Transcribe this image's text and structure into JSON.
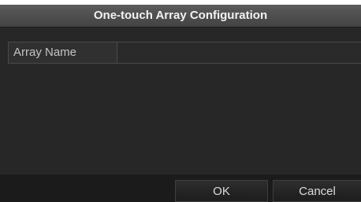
{
  "dialog": {
    "title": "One-touch Array Configuration",
    "fields": {
      "array_name_label": "Array Name",
      "array_name_value": ""
    },
    "buttons": {
      "ok": "OK",
      "cancel": "Cancel"
    }
  }
}
